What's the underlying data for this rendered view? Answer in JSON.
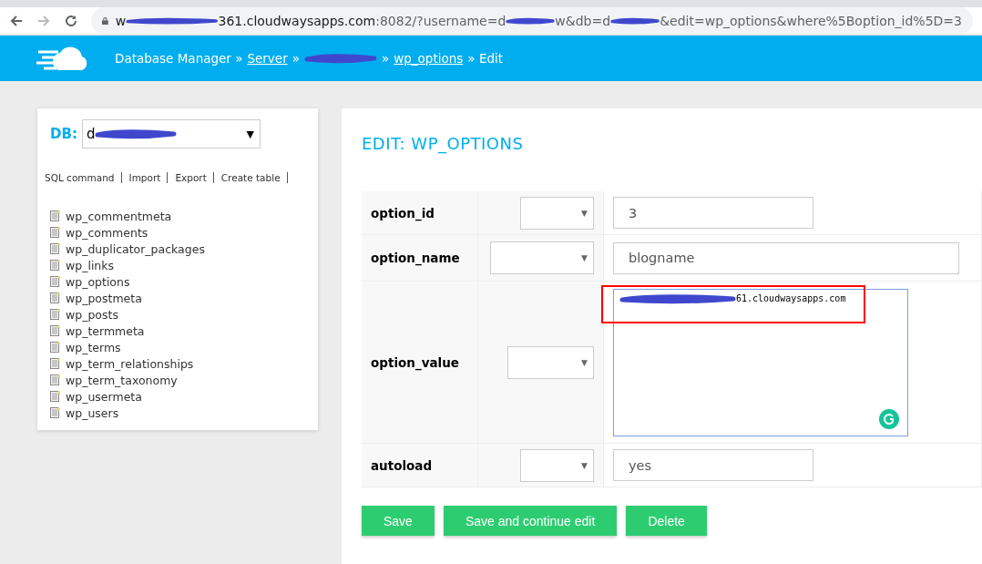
{
  "browser": {
    "url_parts": [
      {
        "kind": "text",
        "text": "w"
      },
      {
        "kind": "redacted"
      },
      {
        "kind": "text",
        "text": "361.cloudwaysapps.com"
      },
      {
        "kind": "dim",
        "text": ":8082/?username=d"
      },
      {
        "kind": "redacted"
      },
      {
        "kind": "dim",
        "text": "w&db=d"
      },
      {
        "kind": "redacted"
      },
      {
        "kind": "dim",
        "text": "&edit=wp_options&where%5Boption_id%5D=3"
      }
    ]
  },
  "breadcrumb": [
    {
      "kind": "text",
      "text": "Database Manager »"
    },
    {
      "kind": "link",
      "text": "Server"
    },
    {
      "kind": "text",
      "text": "»"
    },
    {
      "kind": "redacted-link"
    },
    {
      "kind": "text",
      "text": "»"
    },
    {
      "kind": "link",
      "text": "wp_options"
    },
    {
      "kind": "text",
      "text": "» Edit"
    }
  ],
  "sidebar": {
    "db_label": "DB:",
    "db_value": "d",
    "db_caret": "▼",
    "actions": [
      "SQL command",
      "Import",
      "Export",
      "Create table"
    ],
    "tables": [
      "wp_commentmeta",
      "wp_comments",
      "wp_duplicator_packages",
      "wp_links",
      "wp_options",
      "wp_postmeta",
      "wp_posts",
      "wp_termmeta",
      "wp_terms",
      "wp_term_relationships",
      "wp_term_taxonomy",
      "wp_usermeta",
      "wp_users"
    ]
  },
  "main": {
    "title": "EDIT: WP_OPTIONS",
    "select_caret": "▼",
    "fields": [
      {
        "name": "option_id",
        "kind": "short",
        "value": "3"
      },
      {
        "name": "option_name",
        "kind": "long",
        "value": "blogname"
      },
      {
        "name": "option_value",
        "kind": "textarea",
        "value": "61.cloudwaysapps.com",
        "highlighted": true
      },
      {
        "name": "autoload",
        "kind": "short",
        "value": "yes"
      }
    ],
    "buttons": [
      "Save",
      "Save and continue edit",
      "Delete"
    ]
  }
}
